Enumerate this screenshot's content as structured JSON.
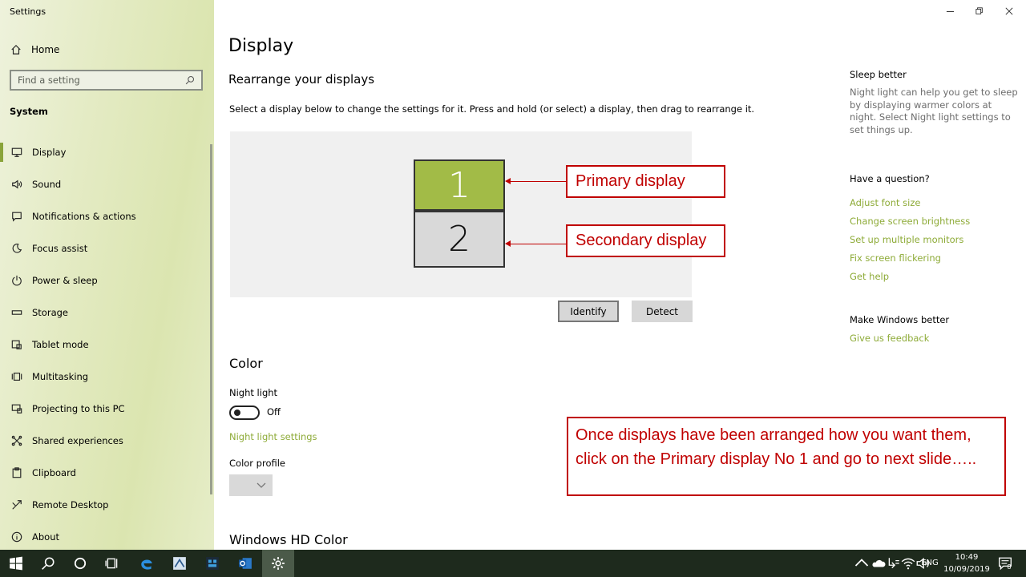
{
  "window": {
    "title": "Settings"
  },
  "sidebar": {
    "home": "Home",
    "search_placeholder": "Find a setting",
    "section": "System",
    "items": [
      {
        "label": "Display",
        "icon": "monitor-icon"
      },
      {
        "label": "Sound",
        "icon": "speaker-icon"
      },
      {
        "label": "Notifications & actions",
        "icon": "notifications-icon"
      },
      {
        "label": "Focus assist",
        "icon": "moon-icon"
      },
      {
        "label": "Power & sleep",
        "icon": "power-icon"
      },
      {
        "label": "Storage",
        "icon": "storage-icon"
      },
      {
        "label": "Tablet mode",
        "icon": "tablet-icon"
      },
      {
        "label": "Multitasking",
        "icon": "multitasking-icon"
      },
      {
        "label": "Projecting to this PC",
        "icon": "projecting-icon"
      },
      {
        "label": "Shared experiences",
        "icon": "shared-icon"
      },
      {
        "label": "Clipboard",
        "icon": "clipboard-icon"
      },
      {
        "label": "Remote Desktop",
        "icon": "remote-desktop-icon"
      },
      {
        "label": "About",
        "icon": "info-icon"
      }
    ]
  },
  "main": {
    "title": "Display",
    "rearrange": {
      "heading": "Rearrange your displays",
      "description": "Select a display below to change the settings for it. Press and hold (or select) a display, then drag to rearrange it.",
      "monitor1": "1",
      "monitor2": "2",
      "identify": "Identify",
      "detect": "Detect"
    },
    "color": {
      "heading": "Color",
      "night_light_label": "Night light",
      "night_light_state": "Off",
      "night_light_settings": "Night light settings",
      "color_profile_label": "Color profile"
    },
    "hd_heading": "Windows HD Color"
  },
  "annotations": {
    "primary": "Primary display",
    "secondary": "Secondary display",
    "note": "Once displays have been arranged how you want them, click on the Primary display No 1 and go to next slide….."
  },
  "right": {
    "sleep_title": "Sleep better",
    "sleep_text": "Night light can help you get to sleep by displaying warmer colors at night. Select Night light settings to set things up.",
    "question_title": "Have a question?",
    "links": [
      "Adjust font size",
      "Change screen brightness",
      "Set up multiple monitors",
      "Fix screen flickering",
      "Get help"
    ],
    "better_title": "Make Windows better",
    "feedback": "Give us feedback"
  },
  "taskbar": {
    "lang": "ENG",
    "time": "10:49",
    "date": "10/09/2019",
    "notif_count": "8"
  },
  "colors": {
    "accent": "#8eab38",
    "monitor_primary": "#a2bb47",
    "callout": "#c00000"
  }
}
